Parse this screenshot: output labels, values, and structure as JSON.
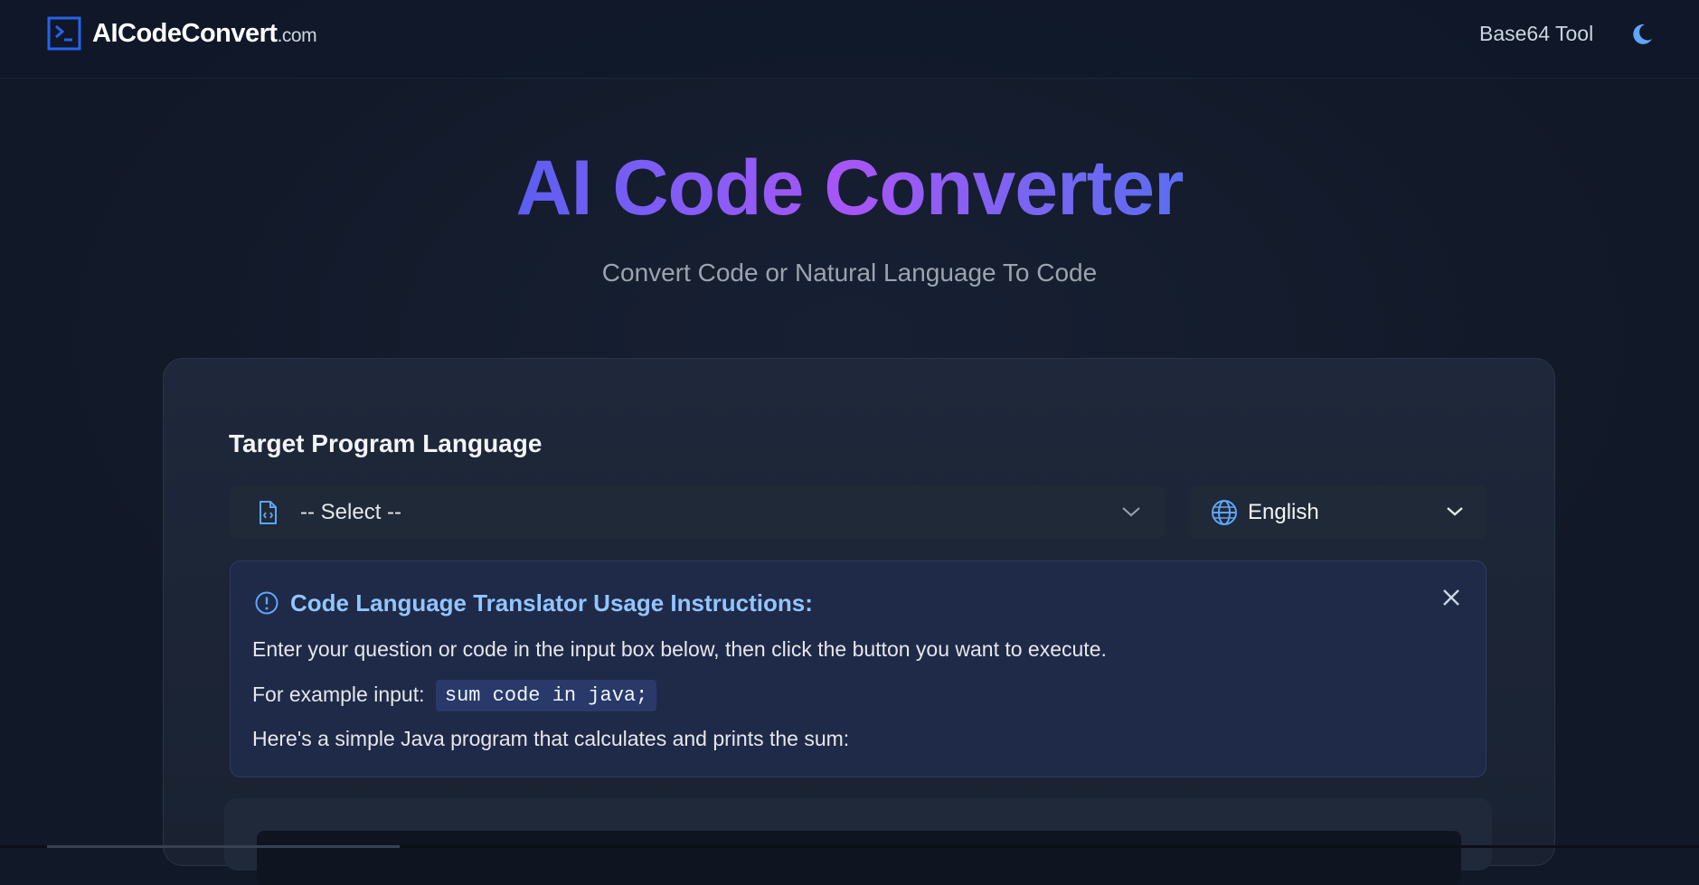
{
  "header": {
    "brand_name": "AICodeConvert",
    "brand_suffix": ".com",
    "nav_link": "Base64 Tool"
  },
  "hero": {
    "title": "AI Code Converter",
    "subtitle": "Convert Code or Natural Language To Code"
  },
  "form": {
    "target_label": "Target Program Language",
    "language_select_value": "-- Select --",
    "locale_select_value": "English"
  },
  "instructions": {
    "title": "Code Language Translator Usage Instructions:",
    "line1": "Enter your question or code in the input box below, then click the button you want to execute.",
    "example_prefix": "For example input:",
    "example_code": "sum code in java;",
    "line3": "Here's a simple Java program that calculates and prints the sum:"
  },
  "colors": {
    "accent": "#2563eb",
    "title_gradient_start": "#5b5ef0",
    "title_gradient_mid": "#a855f7",
    "info_title": "#93c5fd",
    "background": "#111827"
  },
  "icons": {
    "logo": "terminal-icon",
    "theme": "moon-icon",
    "select": "file-code-icon",
    "locale": "globe-icon",
    "info": "alert-circle-icon",
    "close": "close-icon",
    "chevron": "chevron-down-icon"
  }
}
